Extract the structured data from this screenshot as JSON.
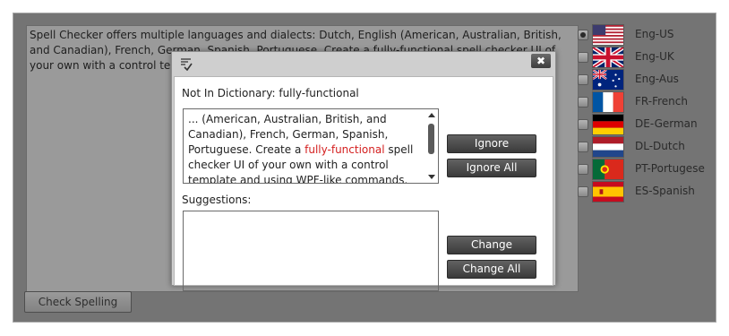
{
  "editor": {
    "text": "Spell Checker offers multiple languages and dialects: Dutch, English (American, Australian, British, and Canadian), French, German, Spanish, Portuguese. Create a fully-functional spell checker UI of your own with a control template and using WPF-like commands. Check multiple text..."
  },
  "check_button_label": "Check Spelling",
  "languages": [
    {
      "label": "Eng-US",
      "checked": true
    },
    {
      "label": "Eng-UK",
      "checked": false
    },
    {
      "label": "Eng-Aus",
      "checked": false
    },
    {
      "label": "FR-French",
      "checked": false
    },
    {
      "label": "DE-German",
      "checked": false
    },
    {
      "label": "DL-Dutch",
      "checked": false
    },
    {
      "label": "PT-Portugese",
      "checked": false
    },
    {
      "label": "ES-Spanish",
      "checked": false
    }
  ],
  "dialog": {
    "close_label": "✖",
    "not_in_dictionary_label": "Not In Dictionary:",
    "not_in_dictionary_word": "fully-functional",
    "context_before": "... (American, Australian, British, and Canadian), French, German, Spanish, Portuguese. Create a ",
    "context_error": "fully-functional",
    "context_after": " spell checker UI of your own with a control template and using WPF-like commands. Check multiple text...",
    "suggestions_label": "Suggestions:",
    "suggestions": [],
    "buttons": {
      "ignore": "Ignore",
      "ignore_all": "Ignore All",
      "change": "Change",
      "change_all": "Change All"
    }
  },
  "colors": {
    "error_text": "#d42020",
    "dark_button": "#3a3a3a",
    "backdrop": "#747474"
  }
}
